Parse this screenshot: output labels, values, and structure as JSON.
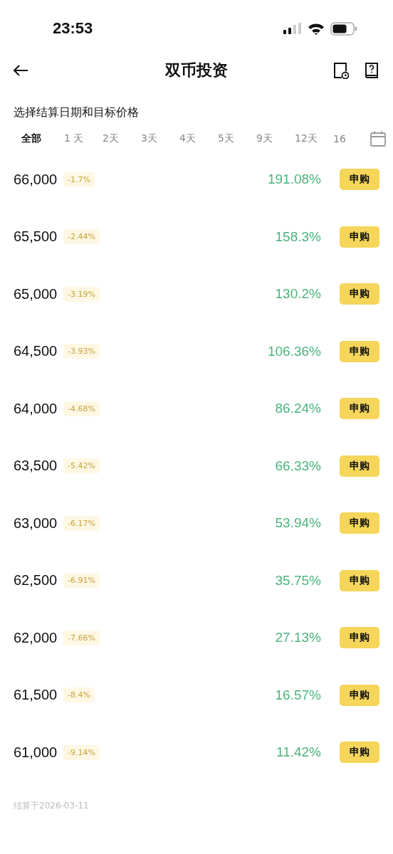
{
  "status_bar": {
    "time": "23:53"
  },
  "header": {
    "title": "双币投资"
  },
  "subtitle": "选择结算日期和目标价格",
  "tabs": [
    {
      "label": "全部",
      "selected": true
    },
    {
      "label": "1 天",
      "selected": false
    },
    {
      "label": "2天",
      "selected": false
    },
    {
      "label": "3天",
      "selected": false
    },
    {
      "label": "4天",
      "selected": false
    },
    {
      "label": "5天",
      "selected": false
    },
    {
      "label": "9天",
      "selected": false
    },
    {
      "label": "12天",
      "selected": false
    },
    {
      "label": "16",
      "selected": false
    }
  ],
  "rows": [
    {
      "price": "66,000",
      "change": "-1.7%",
      "apr": "191.08%",
      "button": "申购"
    },
    {
      "price": "65,500",
      "change": "-2.44%",
      "apr": "158.3%",
      "button": "申购"
    },
    {
      "price": "65,000",
      "change": "-3.19%",
      "apr": "130.2%",
      "button": "申购"
    },
    {
      "price": "64,500",
      "change": "-3.93%",
      "apr": "106.36%",
      "button": "申购"
    },
    {
      "price": "64,000",
      "change": "-4.68%",
      "apr": "86.24%",
      "button": "申购"
    },
    {
      "price": "63,500",
      "change": "-5.42%",
      "apr": "66.33%",
      "button": "申购"
    },
    {
      "price": "63,000",
      "change": "-6.17%",
      "apr": "53.94%",
      "button": "申购"
    },
    {
      "price": "62,500",
      "change": "-6.91%",
      "apr": "35.75%",
      "button": "申购"
    },
    {
      "price": "62,000",
      "change": "-7.66%",
      "apr": "27.13%",
      "button": "申购"
    },
    {
      "price": "61,500",
      "change": "-8.4%",
      "apr": "16.57%",
      "button": "申购"
    },
    {
      "price": "61,000",
      "change": "-9.14%",
      "apr": "11.42%",
      "button": "申购"
    }
  ],
  "footer": "结算于2026-03-11"
}
